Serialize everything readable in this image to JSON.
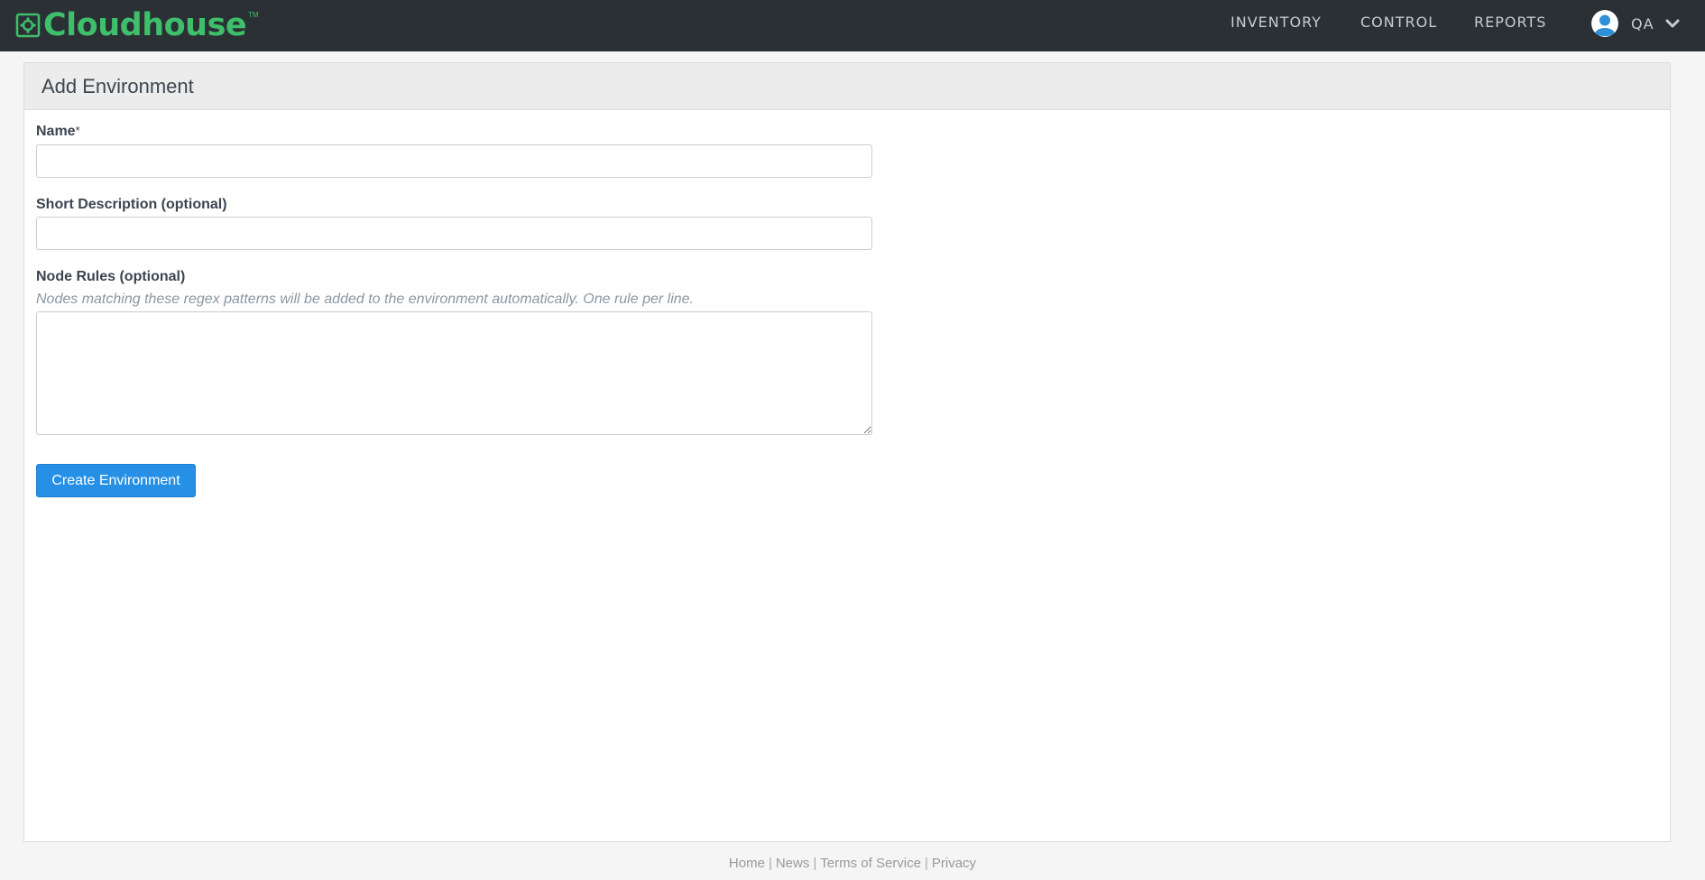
{
  "brand": {
    "name": "Cloudhouse",
    "tm": "TM",
    "color": "#3dbf6b"
  },
  "nav": {
    "items": [
      {
        "label": "INVENTORY"
      },
      {
        "label": "CONTROL"
      },
      {
        "label": "REPORTS"
      }
    ]
  },
  "user": {
    "name": "QA",
    "avatar_icon": "user-avatar-icon",
    "menu_icon": "chevron-down-icon"
  },
  "page": {
    "title": "Add Environment"
  },
  "form": {
    "name_label": "Name",
    "name_required_marker": "*",
    "name_value": "",
    "description_label": "Short Description (optional)",
    "description_value": "",
    "rules_label": "Node Rules (optional)",
    "rules_hint": "Nodes matching these regex patterns will be added to the environment automatically. One rule per line.",
    "rules_value": "",
    "submit_label": "Create Environment",
    "submit_color": "#2590e6"
  },
  "footer": {
    "links": [
      {
        "label": "Home"
      },
      {
        "label": "News"
      },
      {
        "label": "Terms of Service"
      },
      {
        "label": "Privacy"
      }
    ],
    "separator": "|"
  }
}
